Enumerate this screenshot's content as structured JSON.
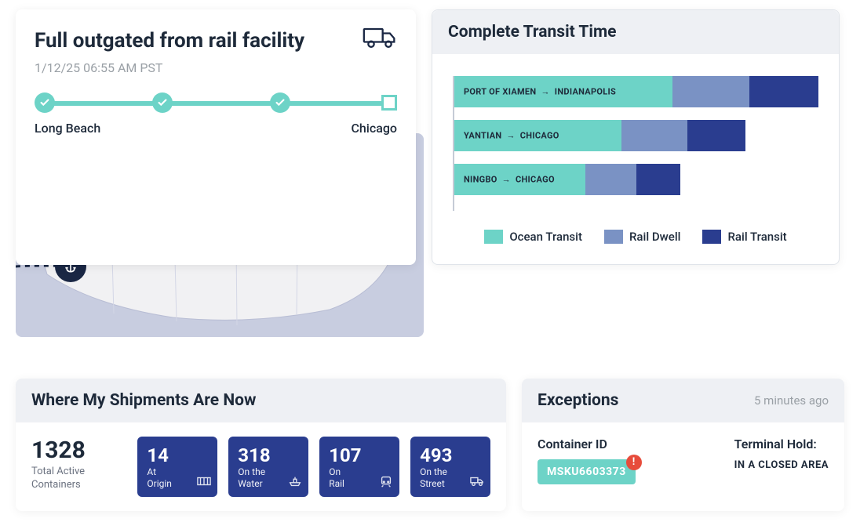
{
  "status": {
    "title": "Full outgated from rail facility",
    "timestamp": "1/12/25 06:55 AM PST",
    "origin": "Long Beach",
    "destination": "Chicago"
  },
  "transit": {
    "title": "Complete Transit Time",
    "legend": {
      "ocean": "Ocean Transit",
      "dwell": "Rail Dwell",
      "rail": "Rail Transit"
    },
    "rows": [
      {
        "from": "PORT OF XIAMEN",
        "to": "INDIANAPOLIS"
      },
      {
        "from": "YANTIAN",
        "to": "CHICAGO"
      },
      {
        "from": "NINGBO",
        "to": "CHICAGO"
      }
    ]
  },
  "chart_data": {
    "type": "bar",
    "title": "Complete Transit Time",
    "categories": [
      "PORT OF XIAMEN → INDIANAPOLIS",
      "YANTIAN → CHICAGO",
      "NINGBO → CHICAGO"
    ],
    "series": [
      {
        "name": "Ocean Transit",
        "values": [
          60,
          46,
          36
        ],
        "color": "#6dd3c7"
      },
      {
        "name": "Rail Dwell",
        "values": [
          21,
          18,
          14
        ],
        "color": "#7a92c4"
      },
      {
        "name": "Rail Transit",
        "values": [
          19,
          16,
          12
        ],
        "color": "#2a3d8f"
      }
    ],
    "xlim": [
      0,
      100
    ],
    "note": "Values are estimated relative bar segment percentages read from the chart; no axis labels present."
  },
  "shipments": {
    "title": "Where My Shipments Are Now",
    "total_value": "1328",
    "total_label": "Total Active Containers",
    "cards": [
      {
        "value": "14",
        "label": "At\nOrigin",
        "icon": "container-icon"
      },
      {
        "value": "318",
        "label": "On the\nWater",
        "icon": "ship-icon"
      },
      {
        "value": "107",
        "label": "On\nRail",
        "icon": "train-icon"
      },
      {
        "value": "493",
        "label": "On the\nStreet",
        "icon": "truck-icon"
      }
    ]
  },
  "exceptions": {
    "title": "Exceptions",
    "time_ago": "5 minutes ago",
    "container_id_label": "Container ID",
    "container_id": "MSKU6603373",
    "hold_label": "Terminal Hold:",
    "hold_text": "IN A CLOSED AREA"
  }
}
